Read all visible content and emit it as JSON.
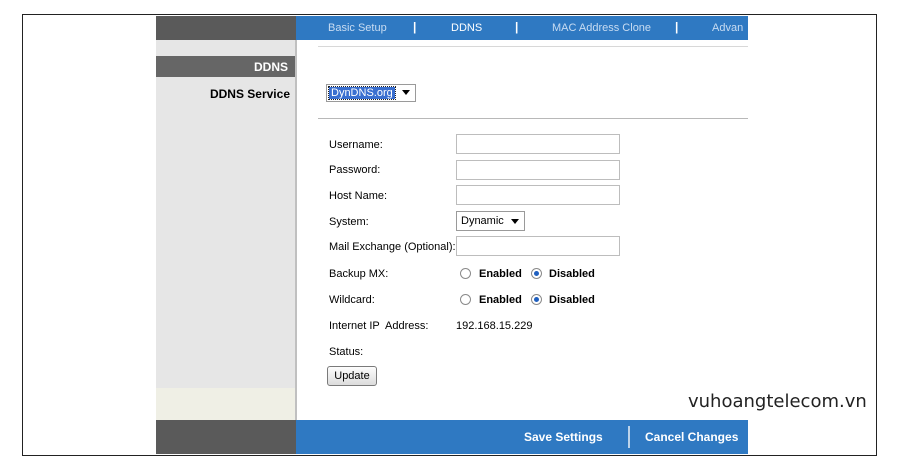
{
  "nav": {
    "items": [
      {
        "label": "Basic Setup",
        "active": false
      },
      {
        "label": "DDNS",
        "active": true
      },
      {
        "label": "MAC Address Clone",
        "active": false
      },
      {
        "label": "Advan",
        "active": false
      }
    ],
    "separator": "|"
  },
  "sidebar": {
    "section_title": "DDNS",
    "item_label": "DDNS Service"
  },
  "ddns_service": {
    "selected": "DynDNS.org"
  },
  "form": {
    "username_label": "Username:",
    "username_value": "",
    "password_label": "Password:",
    "password_value": "",
    "hostname_label": "Host Name:",
    "hostname_value": "",
    "system_label": "System:",
    "system_selected": "Dynamic",
    "mx_label": "Mail Exchange (Optional):",
    "mx_value": "",
    "backup_mx_label": "Backup MX:",
    "backup_mx_enabled_label": "Enabled",
    "backup_mx_disabled_label": "Disabled",
    "backup_mx_value": "Disabled",
    "wildcard_label": "Wildcard:",
    "wildcard_enabled_label": "Enabled",
    "wildcard_disabled_label": "Disabled",
    "wildcard_value": "Disabled",
    "ip_label": "Internet IP  Address:",
    "ip_value": "192.168.15.229",
    "status_label": "Status:",
    "status_value": "",
    "update_button": "Update"
  },
  "footer": {
    "save_label": "Save Settings",
    "cancel_label": "Cancel Changes"
  },
  "watermark": "vuhoangtelecom.vn",
  "colors": {
    "nav_blue": "#2f79c2",
    "sidebar_dark": "#5a5a5a",
    "sidebar_light": "#e6e6e6"
  }
}
